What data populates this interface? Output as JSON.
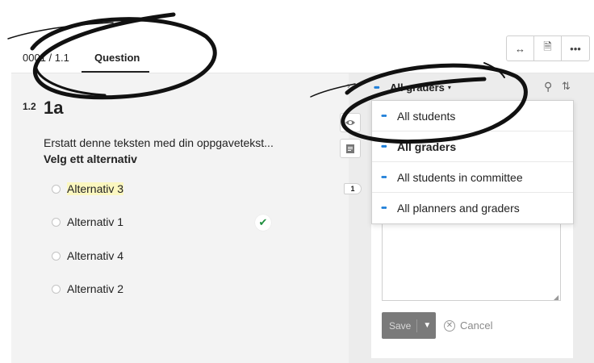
{
  "header": {
    "tabs": [
      {
        "label": "0001 / 1.1"
      },
      {
        "label": "Question"
      }
    ]
  },
  "toolbar": {
    "icons": [
      "resize-horizontal-icon",
      "document-icon",
      "more-icon"
    ],
    "expand_glyph": "↔",
    "document_glyph": "🗎",
    "more_glyph": "•••"
  },
  "question": {
    "number": "1.2",
    "title": "1a",
    "text": "Erstatt denne teksten med din oppgavetekst...",
    "instruction": "Velg ett alternativ",
    "options": [
      {
        "label": "Alternativ 3",
        "highlighted": true
      },
      {
        "label": "Alternativ 1",
        "correct": true
      },
      {
        "label": "Alternativ 4"
      },
      {
        "label": "Alternativ 2"
      }
    ],
    "check_glyph": "✔"
  },
  "gutter": {
    "chevron_glyph": "›",
    "badge": "1"
  },
  "grading": {
    "filter_label": "All graders",
    "caret_glyph": "▾",
    "search_glyph": "⚲",
    "sort_glyph": "⇅",
    "dropdown": [
      {
        "label": "All students"
      },
      {
        "label": "All graders",
        "selected": true
      },
      {
        "label": "All students in committee"
      },
      {
        "label": "All planners and graders"
      }
    ],
    "save_label": "Save",
    "save_caret": "▼",
    "cancel_label": "Cancel",
    "cancel_glyph": "✕"
  },
  "colors": {
    "accent_dots": "#1f7fd8",
    "check": "#1e8e3e",
    "highlight": "#fbf7c0",
    "save_button": "#7a7a7a"
  }
}
